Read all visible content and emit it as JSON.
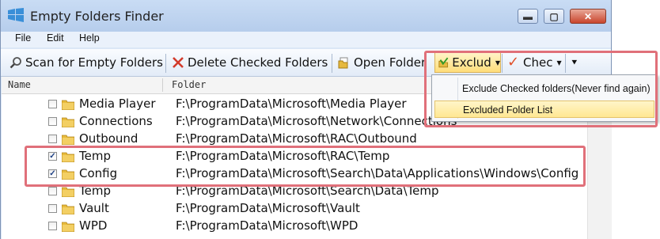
{
  "window": {
    "title": "Empty Folders Finder",
    "minimize_glyph": "▬",
    "maximize_glyph": "▢",
    "close_glyph": "✕"
  },
  "menu": [
    "File",
    "Edit",
    "Help"
  ],
  "toolbar": {
    "scan": "Scan for Empty Folders",
    "delete": "Delete Checked Folders",
    "open": "Open Folder",
    "exclude": "Exclud",
    "check": "Chec",
    "overflow_glyph": "⯆"
  },
  "columns": {
    "name": "Name",
    "folder": "Folder"
  },
  "rows": [
    {
      "name": "Media Player",
      "path": "F:\\ProgramData\\Microsoft\\Media Player",
      "checked": false
    },
    {
      "name": "Connections",
      "path": "F:\\ProgramData\\Microsoft\\Network\\Connections",
      "checked": false
    },
    {
      "name": "Outbound",
      "path": "F:\\ProgramData\\Microsoft\\RAC\\Outbound",
      "checked": false
    },
    {
      "name": "Temp",
      "path": "F:\\ProgramData\\Microsoft\\RAC\\Temp",
      "checked": true
    },
    {
      "name": "Config",
      "path": "F:\\ProgramData\\Microsoft\\Search\\Data\\Applications\\Windows\\Config",
      "checked": true
    },
    {
      "name": "Temp",
      "path": "F:\\ProgramData\\Microsoft\\Search\\Data\\Temp",
      "checked": false
    },
    {
      "name": "Vault",
      "path": "F:\\ProgramData\\Microsoft\\Vault",
      "checked": false
    },
    {
      "name": "WPD",
      "path": "F:\\ProgramData\\Microsoft\\WPD",
      "checked": false
    }
  ],
  "exclude_menu": [
    "Exclude Checked folders(Never find again)",
    "Excluded Folder List"
  ],
  "check_mark": "✓",
  "colors": {
    "highlight_border": "#e0707a",
    "menu_highlight": "#ffe792"
  }
}
